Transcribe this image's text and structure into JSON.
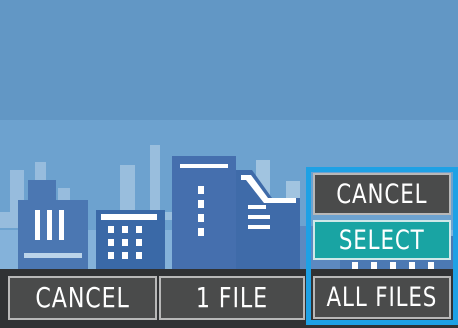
{
  "menu": {
    "cancel_label": "CANCEL",
    "select_label": "SELECT",
    "all_files_label": "ALL FILES"
  },
  "bottom_bar": {
    "cancel_label": "CANCEL",
    "file_count_label": "1 FILE"
  },
  "colors": {
    "sky": "#6fa3cf",
    "menu_border": "#1ea1e5",
    "selected_item": "#19a4a3",
    "button_fill": "#4a4b4b"
  }
}
